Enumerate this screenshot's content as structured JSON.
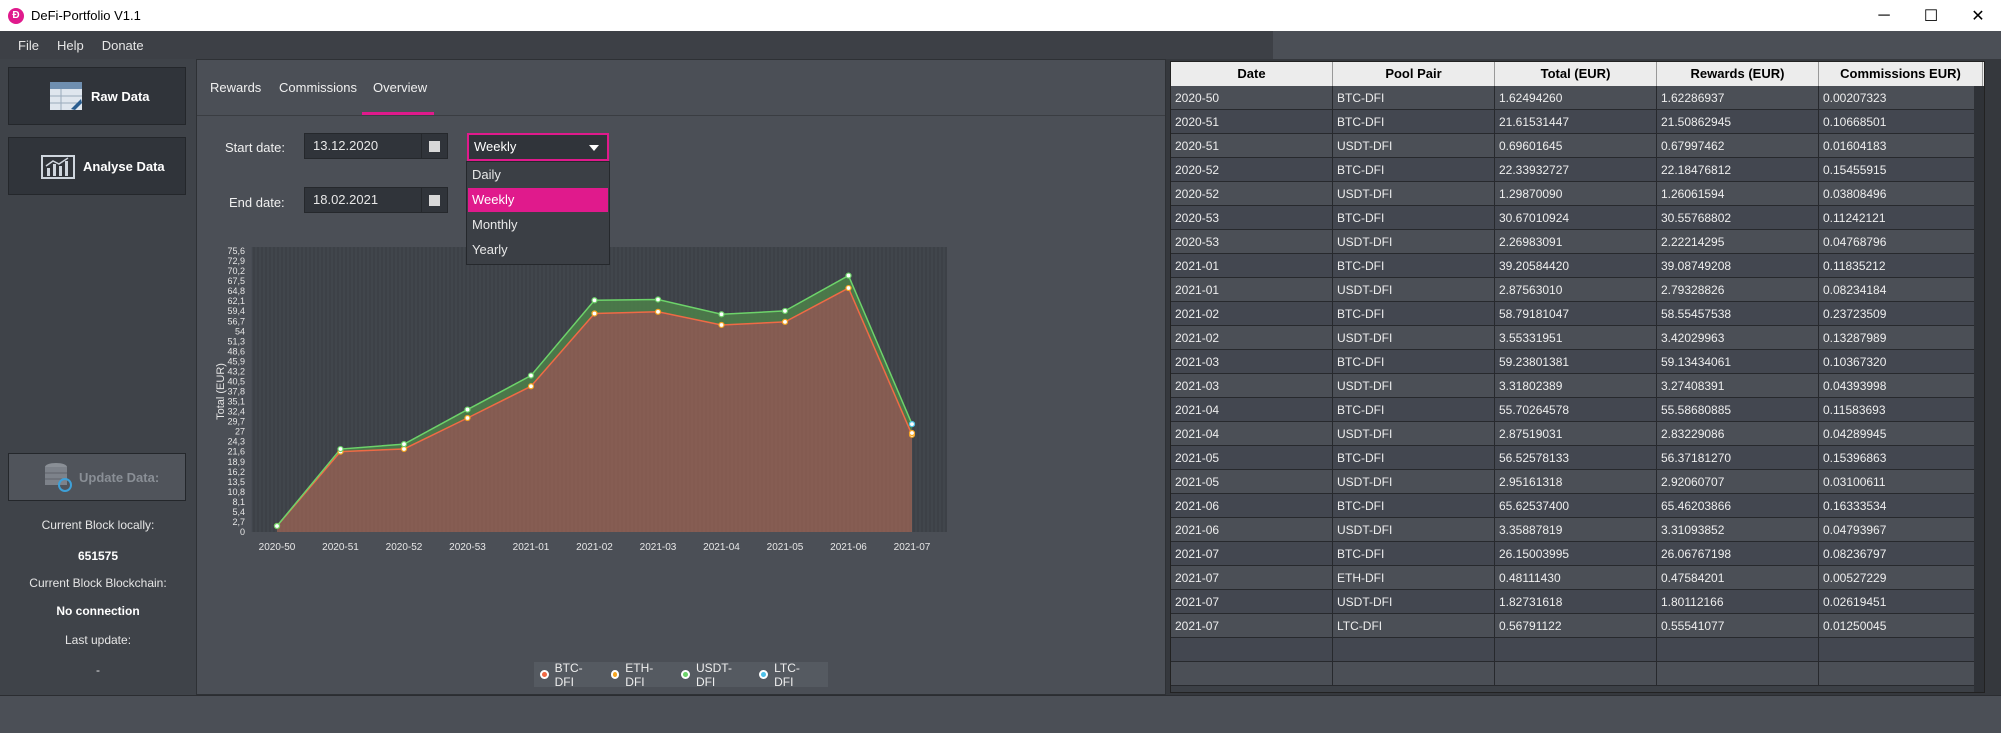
{
  "window": {
    "title": "DeFi-Portfolio V1.1",
    "minimize": "─",
    "maximize": "☐",
    "close": "✕"
  },
  "menu": [
    "File",
    "Help",
    "Donate"
  ],
  "sidebar": {
    "raw_data": "Raw Data",
    "analyse_data": "Analyse Data",
    "update_data": "Update Data:",
    "current_block_local_label": "Current Block locally:",
    "current_block_local_value": "651575",
    "current_block_chain_label": "Current Block Blockchain:",
    "current_block_chain_value": "No connection",
    "last_update_label": "Last update:",
    "last_update_value": "-"
  },
  "tabs": [
    "Rewards",
    "Commissions",
    "Overview"
  ],
  "filters": {
    "start_label": "Start date:",
    "start_value": "13.12.2020",
    "end_label": "End date:",
    "end_value": "18.02.2021",
    "interval_selected": "Weekly",
    "interval_options": [
      "Daily",
      "Weekly",
      "Monthly",
      "Yearly"
    ]
  },
  "colors": {
    "accent": "#e01a8c",
    "btc": "#f06a45",
    "eth": "#f5a623",
    "usdt": "#6dd36a",
    "ltc": "#4fc1e9"
  },
  "chart_data": {
    "type": "area",
    "ylabel": "Total (EUR)",
    "ylim": [
      0,
      75.6
    ],
    "yticks": [
      "0",
      "2,7",
      "5,4",
      "8,1",
      "10,8",
      "13,5",
      "16,2",
      "18,9",
      "21,6",
      "24,3",
      "27",
      "29,7",
      "32,4",
      "35,1",
      "37,8",
      "40,5",
      "43,2",
      "45,9",
      "48,6",
      "51,3",
      "54",
      "56,7",
      "59,4",
      "62,1",
      "64,8",
      "67,5",
      "70,2",
      "72,9",
      "75,6"
    ],
    "categories": [
      "2020-50",
      "2020-51",
      "2020-52",
      "2020-53",
      "2021-01",
      "2021-02",
      "2021-03",
      "2021-04",
      "2021-05",
      "2021-06",
      "2021-07"
    ],
    "series": [
      {
        "name": "BTC-DFI",
        "values": [
          1.62,
          21.62,
          22.34,
          30.67,
          39.21,
          58.79,
          59.24,
          55.7,
          56.53,
          65.63,
          26.15
        ]
      },
      {
        "name": "ETH-DFI",
        "values": [
          0,
          0,
          0,
          0,
          0,
          0,
          0,
          0,
          0,
          0,
          0.48
        ]
      },
      {
        "name": "USDT-DFI",
        "values": [
          0,
          0.7,
          1.3,
          2.27,
          2.88,
          3.55,
          3.32,
          2.88,
          2.95,
          3.36,
          1.83
        ]
      },
      {
        "name": "LTC-DFI",
        "values": [
          0,
          0,
          0,
          0,
          0,
          0,
          0,
          0,
          0,
          0,
          0.57
        ]
      }
    ],
    "legend": [
      "BTC-DFI",
      "ETH-DFI",
      "USDT-DFI",
      "LTC-DFI"
    ]
  },
  "table": {
    "headers": [
      "Date",
      "Pool Pair",
      "Total (EUR)",
      "Rewards (EUR)",
      "Commissions EUR)"
    ],
    "rows": [
      [
        "2020-50",
        "BTC-DFI",
        "1.62494260",
        "1.62286937",
        "0.00207323"
      ],
      [
        "2020-51",
        "BTC-DFI",
        "21.61531447",
        "21.50862945",
        "0.10668501"
      ],
      [
        "2020-51",
        "USDT-DFI",
        "0.69601645",
        "0.67997462",
        "0.01604183"
      ],
      [
        "2020-52",
        "BTC-DFI",
        "22.33932727",
        "22.18476812",
        "0.15455915"
      ],
      [
        "2020-52",
        "USDT-DFI",
        "1.29870090",
        "1.26061594",
        "0.03808496"
      ],
      [
        "2020-53",
        "BTC-DFI",
        "30.67010924",
        "30.55768802",
        "0.11242121"
      ],
      [
        "2020-53",
        "USDT-DFI",
        "2.26983091",
        "2.22214295",
        "0.04768796"
      ],
      [
        "2021-01",
        "BTC-DFI",
        "39.20584420",
        "39.08749208",
        "0.11835212"
      ],
      [
        "2021-01",
        "USDT-DFI",
        "2.87563010",
        "2.79328826",
        "0.08234184"
      ],
      [
        "2021-02",
        "BTC-DFI",
        "58.79181047",
        "58.55457538",
        "0.23723509"
      ],
      [
        "2021-02",
        "USDT-DFI",
        "3.55331951",
        "3.42029963",
        "0.13287989"
      ],
      [
        "2021-03",
        "BTC-DFI",
        "59.23801381",
        "59.13434061",
        "0.10367320"
      ],
      [
        "2021-03",
        "USDT-DFI",
        "3.31802389",
        "3.27408391",
        "0.04393998"
      ],
      [
        "2021-04",
        "BTC-DFI",
        "55.70264578",
        "55.58680885",
        "0.11583693"
      ],
      [
        "2021-04",
        "USDT-DFI",
        "2.87519031",
        "2.83229086",
        "0.04289945"
      ],
      [
        "2021-05",
        "BTC-DFI",
        "56.52578133",
        "56.37181270",
        "0.15396863"
      ],
      [
        "2021-05",
        "USDT-DFI",
        "2.95161318",
        "2.92060707",
        "0.03100611"
      ],
      [
        "2021-06",
        "BTC-DFI",
        "65.62537400",
        "65.46203866",
        "0.16333534"
      ],
      [
        "2021-06",
        "USDT-DFI",
        "3.35887819",
        "3.31093852",
        "0.04793967"
      ],
      [
        "2021-07",
        "BTC-DFI",
        "26.15003995",
        "26.06767198",
        "0.08236797"
      ],
      [
        "2021-07",
        "ETH-DFI",
        "0.48111430",
        "0.47584201",
        "0.00527229"
      ],
      [
        "2021-07",
        "USDT-DFI",
        "1.82731618",
        "1.80112166",
        "0.02619451"
      ],
      [
        "2021-07",
        "LTC-DFI",
        "0.56791122",
        "0.55541077",
        "0.01250045"
      ]
    ]
  }
}
